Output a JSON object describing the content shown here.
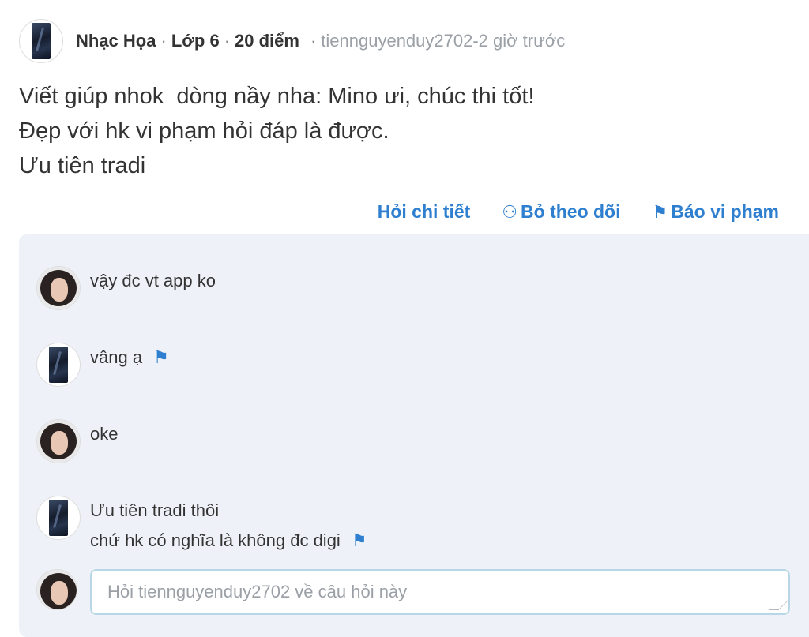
{
  "post": {
    "author": "Nhạc Họa",
    "grade": "Lớp 6",
    "points": "20 điểm",
    "asker": "tiennguyenduy2702",
    "time": "2 giờ trước",
    "question_lines": [
      "Viết giúp nhok  dòng nầy nha: Mino ưi, chúc thi tốt!",
      "Đẹp với hk vi phạm hỏi đáp là được.",
      "Ưu tiên tradi"
    ]
  },
  "actions": {
    "detail": "Hỏi chi tiết",
    "unfollow": "Bỏ theo dõi",
    "report": "Báo vi phạm"
  },
  "comments": [
    {
      "avatar": "girl-avatar",
      "lines": [
        "vậy đc vt app ko"
      ],
      "flag": false
    },
    {
      "avatar": "dark-avatar",
      "lines": [
        "vâng ạ"
      ],
      "flag": true
    },
    {
      "avatar": "girl-avatar",
      "lines": [
        "oke"
      ],
      "flag": false
    },
    {
      "avatar": "dark-avatar",
      "lines": [
        "Ưu tiên tradi thôi",
        "chứ hk có nghĩa là không đc digi"
      ],
      "flag": true
    }
  ],
  "reply": {
    "placeholder": "Hỏi tiennguyenduy2702 về câu hỏi này",
    "value": ""
  },
  "colors": {
    "accent": "#2f7fd0",
    "panel": "#eef2f8",
    "muted": "#9aa0a6"
  }
}
